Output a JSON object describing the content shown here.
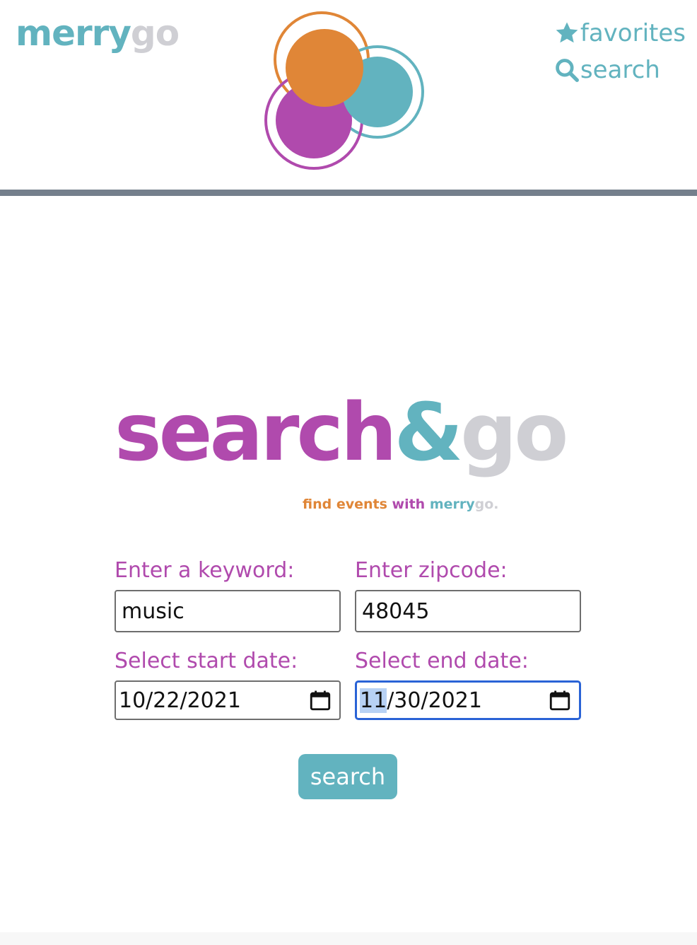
{
  "header": {
    "brand_merry": "merry",
    "brand_go": "go",
    "nav": {
      "favorites_label": "favorites",
      "search_label": "search"
    }
  },
  "main": {
    "wordmark": {
      "search": "search",
      "amp": "&",
      "go": "go"
    },
    "tagline": {
      "find_events": "find events",
      "with": "with",
      "merry": "merry",
      "go": "go."
    },
    "form": {
      "keyword_label": "Enter a keyword:",
      "keyword_value": "music",
      "zipcode_label": "Enter zipcode:",
      "zipcode_value": "48045",
      "start_label": "Select start date:",
      "start_value": "10/22/2021",
      "end_label": "Select end date:",
      "end_value_selected": "11",
      "end_value_rest": "/30/2021",
      "submit_label": "search"
    }
  },
  "colors": {
    "teal": "#62b3bf",
    "purple": "#b04aad",
    "orange": "#e08637",
    "gray": "#cfcfd4",
    "divider": "#747f8c",
    "focus": "#2a63d6"
  },
  "icons": {
    "favorites": "star-icon",
    "search": "magnifier-icon",
    "date_picker": "calendar-icon"
  }
}
